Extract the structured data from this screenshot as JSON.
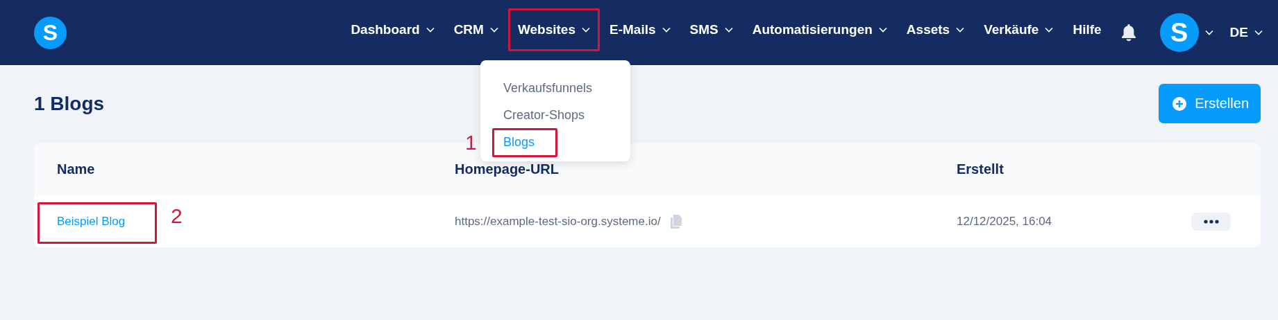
{
  "nav": {
    "logo": "S",
    "items": [
      {
        "label": "Dashboard",
        "kind": "menu",
        "highlighted": false
      },
      {
        "label": "CRM",
        "kind": "menu",
        "highlighted": false
      },
      {
        "label": "Websites",
        "kind": "menu",
        "highlighted": true,
        "dropdown": [
          {
            "label": "Verkaufsfunnels",
            "selected": false,
            "highlighted": false
          },
          {
            "label": "Creator-Shops",
            "selected": false,
            "highlighted": false
          },
          {
            "label": "Blogs",
            "selected": true,
            "highlighted": true,
            "callout": "1"
          }
        ]
      },
      {
        "label": "E-Mails",
        "kind": "menu",
        "highlighted": false
      },
      {
        "label": "SMS",
        "kind": "menu",
        "highlighted": false
      },
      {
        "label": "Automatisierungen",
        "kind": "menu",
        "highlighted": false
      },
      {
        "label": "Assets",
        "kind": "menu",
        "highlighted": false
      },
      {
        "label": "Verkäufe",
        "kind": "menu",
        "highlighted": false
      },
      {
        "label": "Hilfe",
        "kind": "link",
        "highlighted": false
      }
    ],
    "avatar": "S",
    "language": "DE"
  },
  "page": {
    "title": "1 Blogs",
    "create_button": "Erstellen"
  },
  "table": {
    "columns": [
      "Name",
      "Homepage-URL",
      "Erstellt"
    ],
    "rows": [
      {
        "name": "Beispiel Blog",
        "url": "https://example-test-sio-org.systeme.io/",
        "created": "12/12/2025, 16:04",
        "highlighted": true,
        "callout": "2"
      }
    ]
  }
}
